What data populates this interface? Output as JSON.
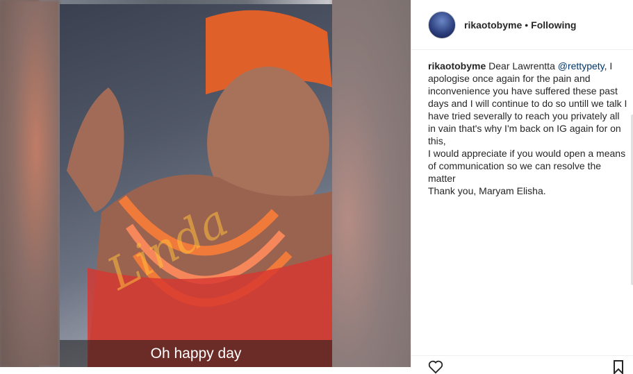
{
  "post": {
    "media_caption": "Oh happy day",
    "watermark": "Linda"
  },
  "header": {
    "username": "rikaotobyme",
    "separator": "•",
    "follow_status": "Following"
  },
  "comment": {
    "username": "rikaotobyme",
    "text_before": " Dear Lawrentta ",
    "mention": "@rettypety",
    "text_after": ", I apologise once again for the pain and inconvenience you have suffered these past days and I will continue to do so untill we talk I have tried severally to reach you privately all in vain that's why I'm back on IG again for on this,\nI would appreciate if you would open a means of communication so we can resolve the matter\nThank you, Maryam Elisha."
  },
  "icons": {
    "like": "heart-icon",
    "save": "bookmark-icon"
  },
  "colors": {
    "mention": "#003569",
    "text": "#262626",
    "border": "#efefef"
  }
}
